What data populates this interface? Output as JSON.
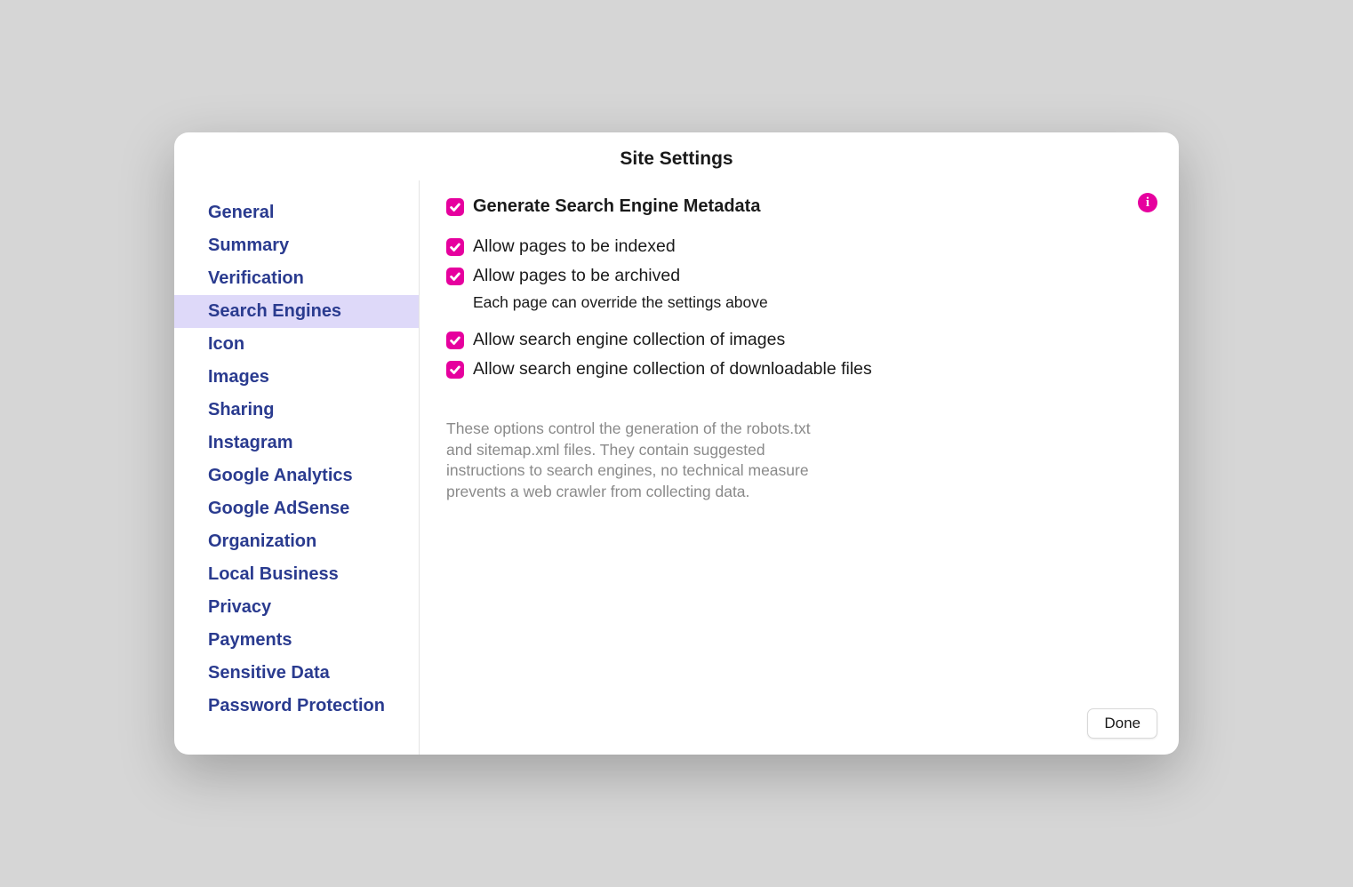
{
  "dialog": {
    "title": "Site Settings"
  },
  "sidebar": {
    "items": [
      {
        "label": "General",
        "selected": false
      },
      {
        "label": "Summary",
        "selected": false
      },
      {
        "label": "Verification",
        "selected": false
      },
      {
        "label": "Search Engines",
        "selected": true
      },
      {
        "label": "Icon",
        "selected": false
      },
      {
        "label": "Images",
        "selected": false
      },
      {
        "label": "Sharing",
        "selected": false
      },
      {
        "label": "Instagram",
        "selected": false
      },
      {
        "label": "Google Analytics",
        "selected": false
      },
      {
        "label": "Google AdSense",
        "selected": false
      },
      {
        "label": "Organization",
        "selected": false
      },
      {
        "label": "Local Business",
        "selected": false
      },
      {
        "label": "Privacy",
        "selected": false
      },
      {
        "label": "Payments",
        "selected": false
      },
      {
        "label": "Sensitive Data",
        "selected": false
      },
      {
        "label": "Password Protection",
        "selected": false
      }
    ]
  },
  "content": {
    "header": {
      "label": "Generate Search Engine Metadata",
      "checked": true
    },
    "options1": [
      {
        "label": "Allow pages to be indexed",
        "checked": true
      },
      {
        "label": "Allow pages to be archived",
        "checked": true
      }
    ],
    "sub_note": "Each page can override the settings above",
    "options2": [
      {
        "label": "Allow search engine collection of images",
        "checked": true
      },
      {
        "label": "Allow search engine collection of downloadable files",
        "checked": true
      }
    ],
    "description": "These options control the generation of the robots.txt and sitemap.xml files. They contain suggested instructions to search engines, no technical measure prevents a web crawler from collecting data."
  },
  "footer": {
    "done_label": "Done"
  },
  "colors": {
    "accent": "#e6009e",
    "sidebar_text": "#2a3b8f",
    "selected_bg": "#ded9f9"
  }
}
